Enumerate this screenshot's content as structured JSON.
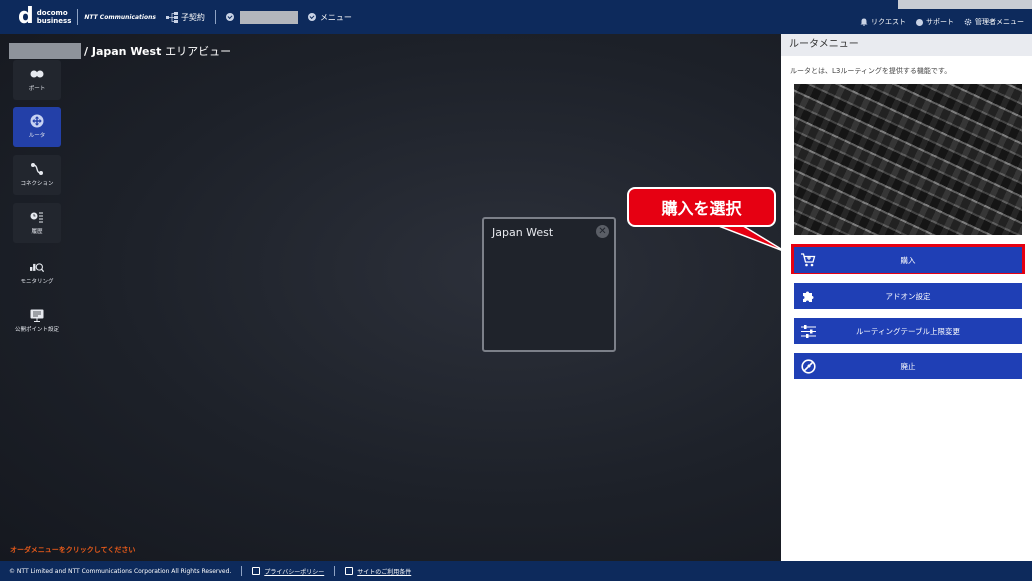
{
  "header": {
    "logo_mark": "d",
    "logo_line1": "docomo",
    "logo_line2": "business",
    "ntt_logo": "NTT Communications",
    "contract_label": "子契約",
    "menu_label": "メニュー",
    "right": {
      "request": "リクエスト",
      "support": "サポート",
      "admin_menu": "管理者メニュー"
    }
  },
  "breadcrumb": {
    "text": "/ Japan West",
    "suffix": "エリアビュー"
  },
  "sidebar": {
    "items": [
      {
        "label": "ポート",
        "icon": "toggle-icon",
        "active": false
      },
      {
        "label": "ルータ",
        "icon": "router-icon",
        "active": true
      },
      {
        "label": "コネクション",
        "icon": "connection-icon",
        "active": false
      },
      {
        "label": "履歴",
        "icon": "history-icon",
        "active": false
      },
      {
        "label": "モニタリング",
        "icon": "monitoring-icon",
        "active": false
      },
      {
        "label": "公開ポイント設定",
        "icon": "monitor-icon",
        "active": false
      }
    ]
  },
  "order_hint": "オーダメニューをクリックしてください",
  "region_card": {
    "title": "Japan West",
    "close_glyph": "✕"
  },
  "panel": {
    "title": "ルータメニュー",
    "description": "ルータとは、L3ルーティングを提供する機能です。",
    "image_icon": "server-rack-photo",
    "buttons": [
      {
        "label": "購入",
        "icon": "cart-icon"
      },
      {
        "label": "アドオン設定",
        "icon": "puzzle-icon"
      },
      {
        "label": "ルーティングテーブル上限変更",
        "icon": "sliders-icon"
      },
      {
        "label": "廃止",
        "icon": "cancel-icon"
      }
    ]
  },
  "callout": {
    "text": "購入を選択"
  },
  "footer": {
    "copyright": "© NTT Limited and NTT Communications Corporation All Rights Reserved.",
    "privacy": "プライバシーポリシー",
    "terms": "サイトのご利用条件"
  },
  "colors": {
    "header_bg": "#0d2a5c",
    "accent_blue": "#1f3fb5",
    "highlight_red": "#e60012",
    "hint_orange": "#e85a1a"
  }
}
